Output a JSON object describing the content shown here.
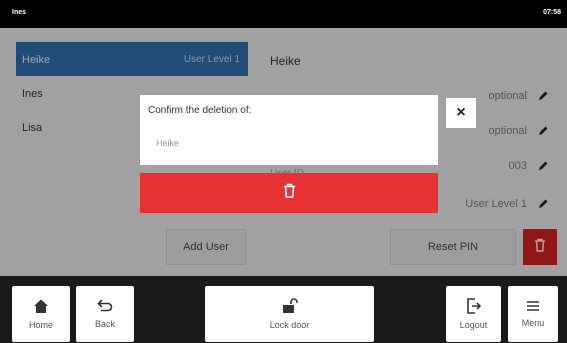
{
  "statusbar": {
    "user": "Ines",
    "time": "07:58"
  },
  "users": [
    {
      "name": "Heike",
      "level": "User Level 1",
      "selected": true
    },
    {
      "name": "Ines",
      "level": "",
      "selected": false
    },
    {
      "name": "Lisa",
      "level": "",
      "selected": false
    }
  ],
  "detail": {
    "name": "Heike",
    "field1_value": "optional",
    "field2_value": "optional",
    "userid_label": "User ID",
    "userid_value": "003",
    "level_value": "User Level 1"
  },
  "actions": {
    "add_user": "Add User",
    "reset_pin": "Reset PIN"
  },
  "dialog": {
    "title": "Confirm the deletion of:",
    "target": "Heike",
    "close_symbol": "×"
  },
  "bottom": {
    "home": "Home",
    "back": "Back",
    "lock_door": "Lock door",
    "logout": "Logout",
    "menu": "Menu"
  },
  "colors": {
    "selected": "#2f6aa6",
    "delete_red": "#e63232",
    "delete_dark_red": "#c91f1f"
  },
  "icons": [
    "home-icon",
    "back-arrow-icon",
    "unlock-icon",
    "logout-icon",
    "menu-icon",
    "trash-icon",
    "pencil-icon",
    "close-icon"
  ]
}
